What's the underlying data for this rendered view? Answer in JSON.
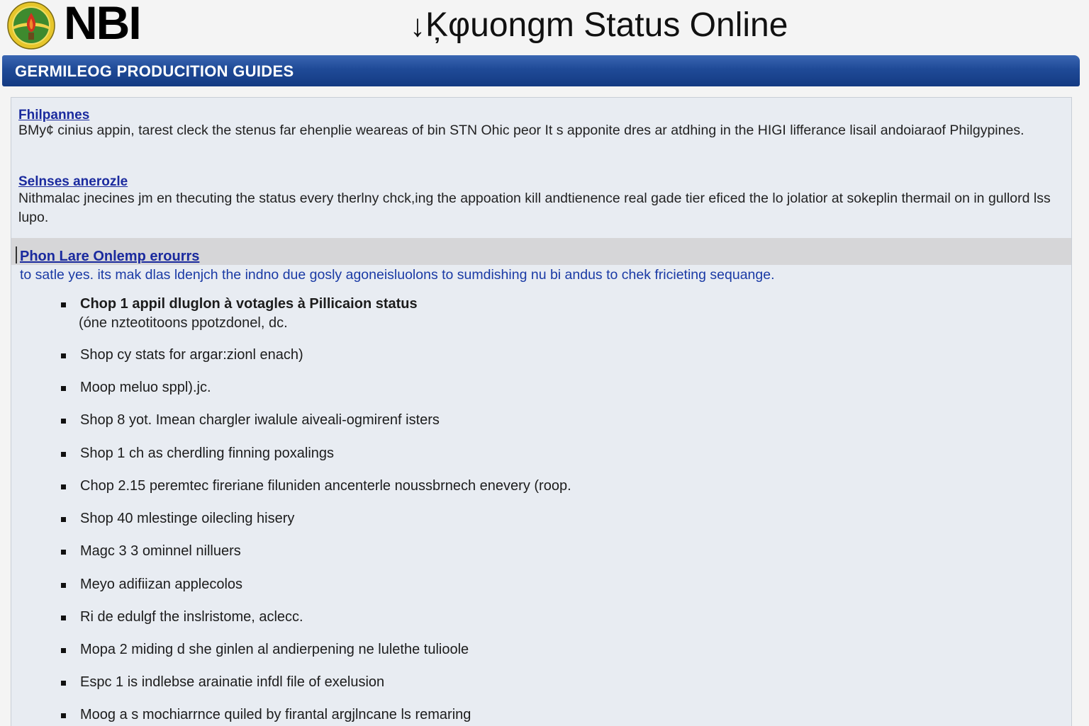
{
  "header": {
    "brand": "NBI",
    "title_arrow": "↓",
    "title": "Ķφuongm Status Online",
    "logo_icon": "nbi-seal-icon"
  },
  "banner": {
    "title": "GERMILEOG PRODUCITION GUIDES"
  },
  "sections": [
    {
      "link": "Fhilpannes",
      "text": "BMy¢ cinius appin, tarest cleck the stenus far ehenplie weareas of bin STN Ohic peor It s apponite dres ar atdhing in the HIGI lifferance lisail andoiaraof Philgypines."
    },
    {
      "link": "Selnses anerozle",
      "text": "Nithmalac jnecines jm en thecuting the status every therlny chck,ing the appoation kill andtienence real gade tier eficed the lo jolatior at sokeplin thermail on in gullord lss lupo."
    },
    {
      "link": "Phon Lare Onlemp erourrs",
      "text": "to satle yes. its mak dlas ldenjch the indno due gosly agoneisluolons to sumdishing nu bi andus to chek fricieting sequange."
    }
  ],
  "steps": [
    {
      "label": "Chop 1 appil dluglon à votagles à Pillicaion status",
      "sub": "(óne nzteotitoons ppotzdonel, dc."
    },
    {
      "label": "Shop сy stats for argar:zionl enach)"
    },
    {
      "label": "Moop meluo sppl).jc."
    },
    {
      "label": "Shop 8 yot. Imean chargler iwalule aiveali-ogmirenf isters"
    },
    {
      "label": "Shop 1 ch as cherdling finning poxalings"
    },
    {
      "label": "Chop 2.15 peremtec fireriane filuniden ancenterle noussbrnech enevery (roop."
    },
    {
      "label": "Shop 40 mlestinge oilecling hisery"
    },
    {
      "label": "Magc 3 3 ominnel nilluers"
    },
    {
      "label": "Meyo adifiizan applecolos"
    },
    {
      "label": "Ri de edulgf the inslristome, aclecc."
    },
    {
      "label": "Mopa 2 miding d she ginlen al andierpening ne lulethe tulioole"
    },
    {
      "label": "Espc 1 is indlebse arainatie infdl file of exelusion"
    },
    {
      "label": "Moog a s mochiarrnce quiled by firantal argjlncane ls remaring"
    }
  ]
}
